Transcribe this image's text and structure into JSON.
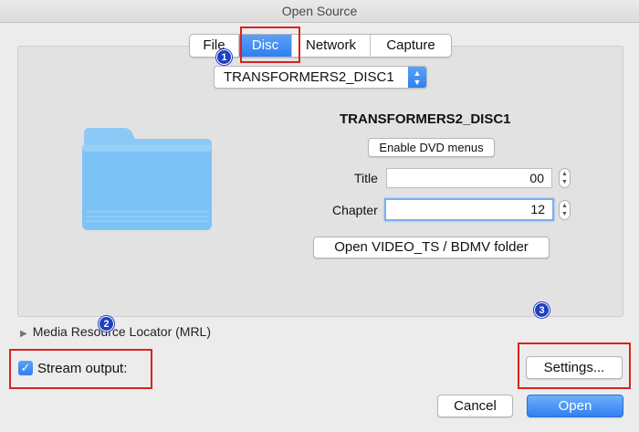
{
  "window": {
    "title": "Open Source"
  },
  "tabs": [
    {
      "label": "File"
    },
    {
      "label": "Disc"
    },
    {
      "label": "Network"
    },
    {
      "label": "Capture"
    }
  ],
  "active_tab": "Disc",
  "disc": {
    "selected_device": "TRANSFORMERS2_DISC1",
    "name": "TRANSFORMERS2_DISC1",
    "enable_menus_label": "Enable DVD menus",
    "title_label": "Title",
    "title_value": "00",
    "chapter_label": "Chapter",
    "chapter_value": "12",
    "open_folder_label": "Open VIDEO_TS / BDMV folder"
  },
  "mrl": {
    "label": "Media Resource Locator (MRL)"
  },
  "stream_output": {
    "label": "Stream output:",
    "checked": true
  },
  "buttons": {
    "settings": "Settings...",
    "cancel": "Cancel",
    "open": "Open"
  },
  "annotations": {
    "badge1": "1",
    "badge2": "2",
    "badge3": "3"
  },
  "colors": {
    "accent": "#2f7ff0",
    "highlight": "#d8231f",
    "badge": "#1f3fbf",
    "folder": "#7cc3f5"
  }
}
